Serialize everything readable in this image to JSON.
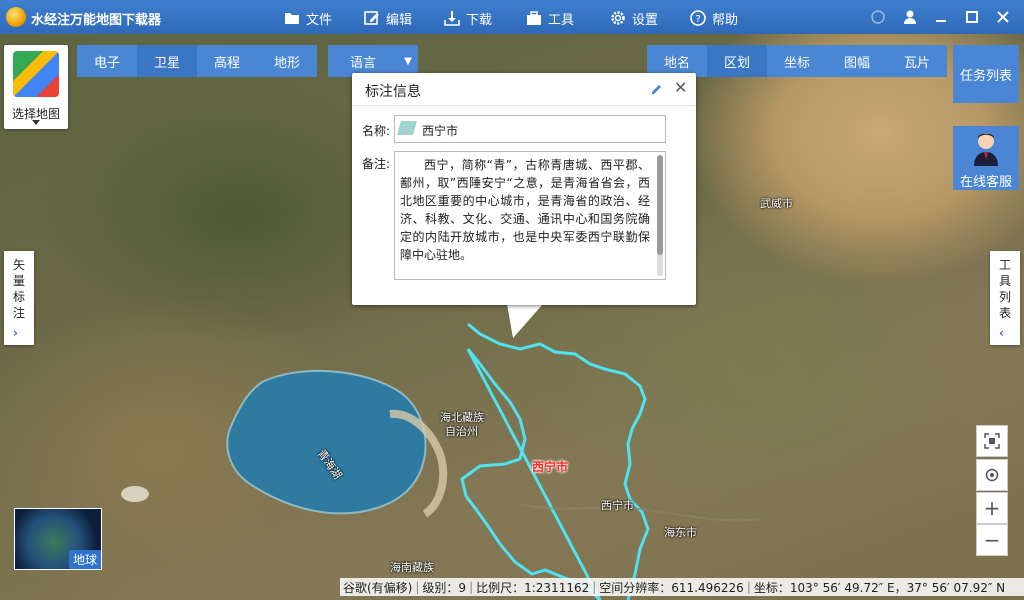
{
  "app": {
    "title": "水经注万能地图下载器"
  },
  "menu": [
    {
      "label": "文件",
      "icon": "folder-icon"
    },
    {
      "label": "编辑",
      "icon": "edit-icon"
    },
    {
      "label": "下载",
      "icon": "download-icon"
    },
    {
      "label": "工具",
      "icon": "toolbox-icon"
    },
    {
      "label": "设置",
      "icon": "gear-icon"
    },
    {
      "label": "帮助",
      "icon": "help-icon"
    }
  ],
  "map_select": {
    "label": "选择地图"
  },
  "map_types": [
    "电子",
    "卫星",
    "高程",
    "地形"
  ],
  "active_map_type": "卫星",
  "language": {
    "label": "语言"
  },
  "right_tools": [
    "地名",
    "区划",
    "坐标",
    "图幅",
    "瓦片"
  ],
  "active_right_tool": "区划",
  "task_list": {
    "label": "任务列表"
  },
  "online_support": {
    "label": "在线客服"
  },
  "side_left": {
    "label": [
      "矢",
      "量",
      "标",
      "注"
    ]
  },
  "side_right": {
    "label": [
      "工",
      "具",
      "列",
      "表"
    ]
  },
  "popup": {
    "title": "标注信息",
    "name_label": "名称:",
    "name_value": "西宁市",
    "note_label": "备注:",
    "note_value": "西宁，简称“青”，古称青唐城、西平郡、鄯州，取”西陲安宁“之意，是青海省省会，西北地区重要的中心城市，是青海省的政治、经济、科教、文化、交通、通讯中心和国务院确定的内陆开放城市，也是中央军委西宁联勤保障中心驻地。"
  },
  "map_labels": {
    "wuwei": "武威市",
    "haibei_1": "海北藏族",
    "haibei_2": "自治州",
    "qinghai_lake": "青海湖",
    "xining_region": "西宁市",
    "xining_city": "西宁市",
    "haidong": "海东市",
    "hainan": "海南藏族"
  },
  "globe": {
    "label": "地球"
  },
  "status": {
    "source": "谷歌(有偏移)",
    "level": "级别：9",
    "scale": "比例尺：1:2311162",
    "resolution": "空间分辨率：611.496226",
    "coords": "坐标：103° 56′ 49.72″ E，37° 56′ 07.92″ N"
  },
  "colors": {
    "accent": "#4a86d4",
    "boundary": "#4fe3f0",
    "region_label": "#ff2a2a"
  }
}
